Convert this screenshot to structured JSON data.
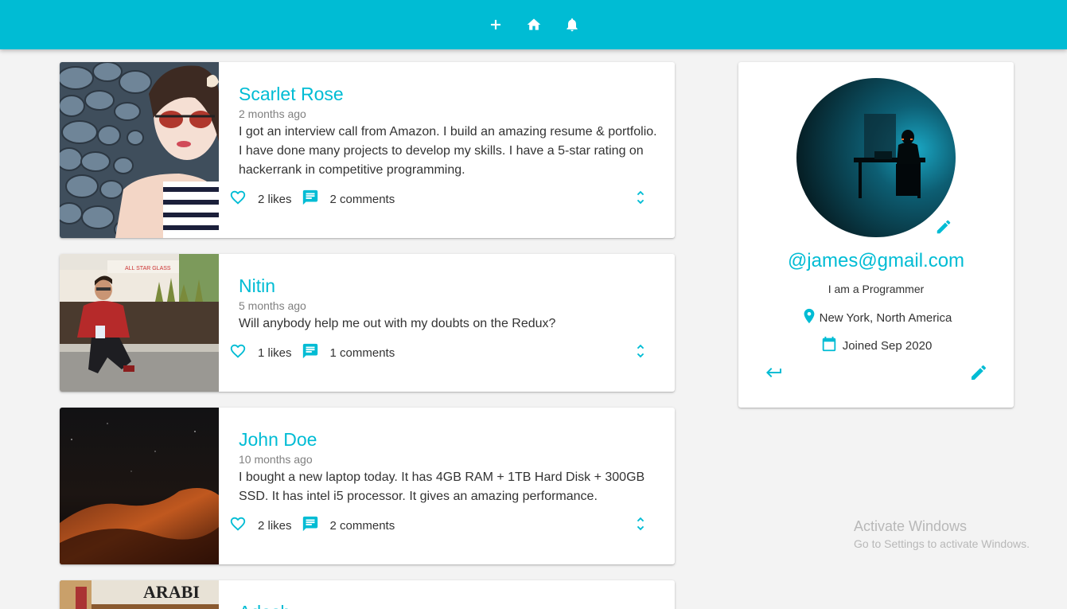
{
  "appbar": {
    "icons": [
      "plus-icon",
      "home-icon",
      "bell-icon"
    ],
    "color": "#00bcd4"
  },
  "posts": [
    {
      "author": "Scarlet Rose",
      "time": "2 months ago",
      "body": "I got an interview call from Amazon. I build an amazing resume & portfolio. I have done many projects to develop my skills. I have a 5-star rating on hackerrank in competitive programming.",
      "likes": "2 likes",
      "comments": "2 comments"
    },
    {
      "author": "Nitin",
      "time": "5 months ago",
      "body": "Will anybody help me out with my doubts on the Redux?",
      "likes": "1 likes",
      "comments": "1 comments"
    },
    {
      "author": "John Doe",
      "time": "10 months ago",
      "body": "I bought a new laptop today. It has 4GB RAM + 1TB Hard Disk + 300GB SSD. It has intel i5 processor. It gives an amazing performance.",
      "likes": "2 likes",
      "comments": "2 comments"
    },
    {
      "author": "Adesh",
      "thumb_sign": "ARABI"
    }
  ],
  "profile": {
    "handle": "@james@gmail.com",
    "bio": "I am a Programmer",
    "location": "New York, North America",
    "joined": "Joined Sep 2020"
  },
  "watermark": {
    "title": "Activate Windows",
    "subtitle": "Go to Settings to activate Windows."
  },
  "colors": {
    "accent": "#00bcd4",
    "background": "#f3f3f3"
  }
}
